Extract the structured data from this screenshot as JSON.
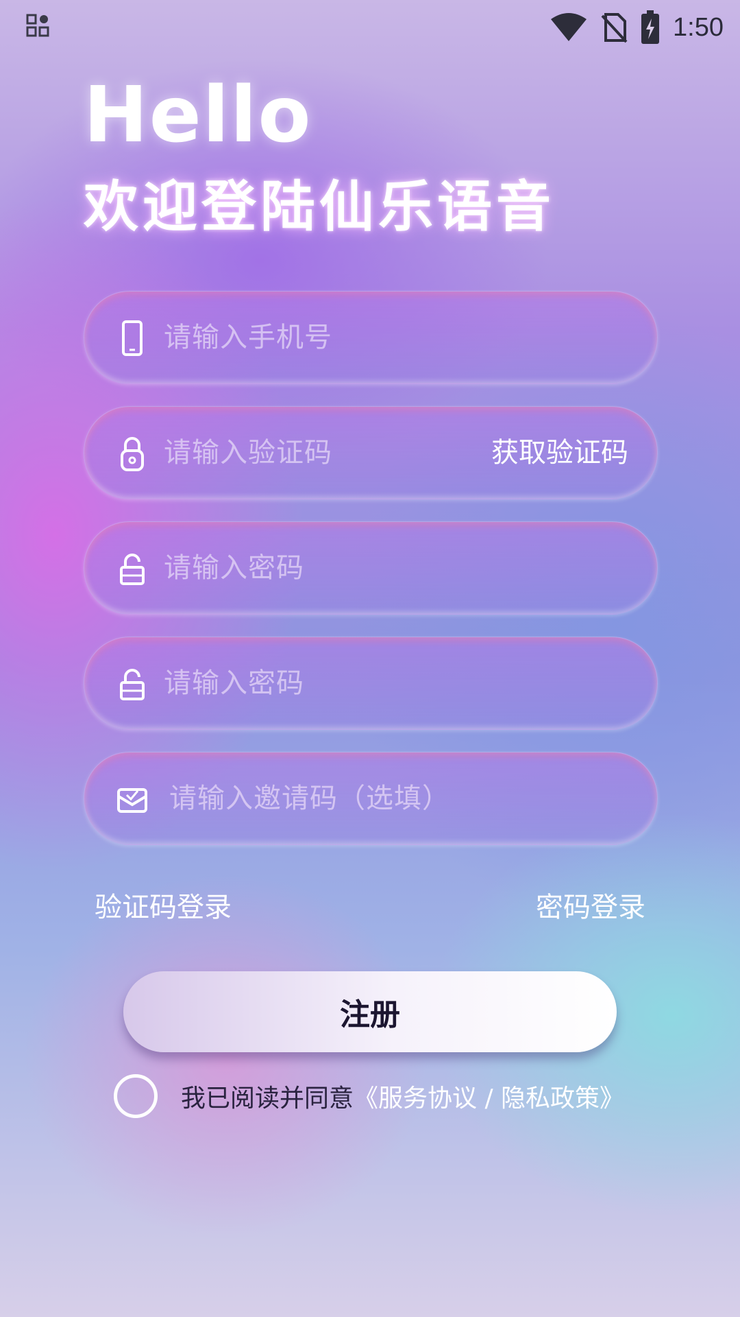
{
  "status_bar": {
    "time": "1:50"
  },
  "header": {
    "hello": "Hello",
    "welcome": "欢迎登陆仙乐语音"
  },
  "form": {
    "phone_placeholder": "请输入手机号",
    "code_placeholder": "请输入验证码",
    "get_code_label": "获取验证码",
    "password_placeholder": "请输入密码",
    "confirm_password_placeholder": "请输入密码",
    "invite_placeholder": "请输入邀请码（选填）"
  },
  "links": {
    "code_login": "验证码登录",
    "password_login": "密码登录"
  },
  "register_label": "注册",
  "agreement": {
    "prefix": "我已阅读并同意",
    "link": "《服务协议 / 隐私政策》",
    "checked": false
  },
  "icons": {
    "status_left": "qr-grid-icon",
    "wifi": "wifi-icon",
    "no_sim": "no-sim-icon",
    "battery": "battery-charging-icon",
    "phone": "phone-icon",
    "lock": "lock-icon",
    "unlock": "unlock-icon",
    "invite": "envelope-icon"
  }
}
